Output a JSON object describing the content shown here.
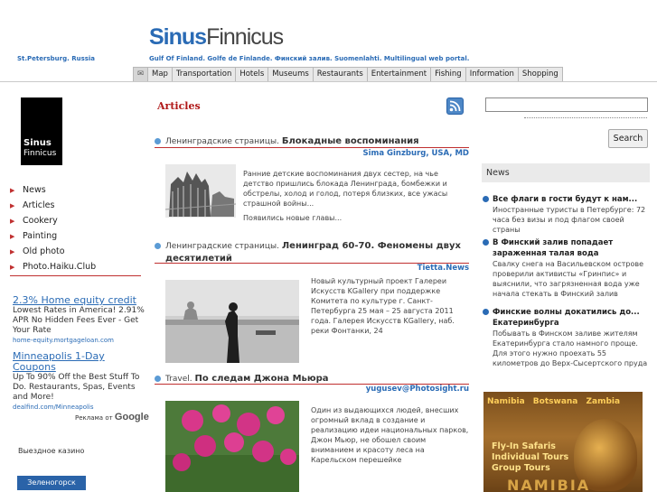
{
  "header": {
    "logo_sinus": "Sinus",
    "logo_finnicus": "Finnicus",
    "city": "St.Petersburg. Russia",
    "tagline": "Gulf Of Finland. Golfe de Finlande. Финский залив. Suomenlahti. Multilingual web portal."
  },
  "nav": {
    "mail_icon": "✉",
    "items": [
      "Map",
      "Transportation",
      "Hotels",
      "Museums",
      "Restaurants",
      "Entertainment",
      "Fishing",
      "Information",
      "Shopping"
    ]
  },
  "sidebar": {
    "logo_line1": "Sinus",
    "logo_line2": "Finnicus",
    "items": [
      "News",
      "Articles",
      "Cookery",
      "Painting",
      "Old photo",
      "Photo.Haiku.Club"
    ]
  },
  "ads": [
    {
      "title": "2.3% Home equity credit",
      "text": "Lowest Rates in America! 2.91% APR No Hidden Fees Ever - Get Your Rate",
      "url": "home-equity.mortgageloan.com"
    },
    {
      "title": "Minneapolis 1-Day Coupons",
      "text": "Up To 90% Off the Best Stuff To Do. Restaurants, Spas, Events and More!",
      "url": "dealfind.com/Minneapolis"
    }
  ],
  "ads_by": {
    "label": "Реклама от",
    "brand": "Google"
  },
  "casino": "Выездное казино",
  "zelenogorsk_button": "Зеленогорск",
  "articles": {
    "heading": "Articles",
    "list": [
      {
        "prefix": "Ленинградские страницы.",
        "title": "Блокадные воспоминания",
        "author": "Sima Ginzburg, USA, MD",
        "text": "Ранние детские воспоминания двух сестер, на чье детство пришлись блокада Ленинграда, бомбежки и обстрелы, холод и голод, потеря близких, все ужасы страшной войны...",
        "more": "Появились новые главы..."
      },
      {
        "prefix": "Ленинградские страницы.",
        "title": "Ленинград 60-70. Феномены двух десятилетий",
        "author": "Tietta.News",
        "text": "Новый культурный проект Галереи Искусств KGallery при поддержке Комитета по культуре г. Санкт-Петербурга 25 мая – 25 августа 2011 года. Галерея Искусств KGallery, наб. реки Фонтанки, 24"
      },
      {
        "prefix": "Travel.",
        "title": "По следам Джона Мьюра",
        "author": "yugusev@Photosight.ru",
        "text": "Один из выдающихся людей, внесших огромный вклад в создание и реализацию идеи национальных парков, Джон Мьюр, не обошел своим вниманием и красоту леса на Карельском перешейке"
      }
    ]
  },
  "search": {
    "placeholder": "",
    "button": "Search"
  },
  "news": {
    "header": "News",
    "items": [
      {
        "title": "Все флаги в гости будут к нам...",
        "text": "Иностранные туристы в Петербурге: 72 часа без визы и под флагом своей страны"
      },
      {
        "title": "В Финский залив попадает зараженная талая вода",
        "text": "Свалку снега на Васильевском острове проверили активисты «Гринпис» и выяснили, что загрязненная вода уже начала стекать в Финский залив"
      },
      {
        "title": "Финские волны докатились до... Екатеринбурга",
        "text": "Побывать в Финском заливе жителям Екатеринбурга стало намного проще. Для этого нужно проехать 55 километров до Верх-Сысертского пруда"
      }
    ]
  },
  "africa_ad": {
    "countries": "Namibia Botswana Zambia",
    "line1": "Fly-In Safaris",
    "line2": "Individual Tours",
    "line3": "Group Tours",
    "name": "NAMIBIA"
  },
  "colors": {
    "accent_blue": "#2a6bb5",
    "accent_red": "#b01818"
  }
}
